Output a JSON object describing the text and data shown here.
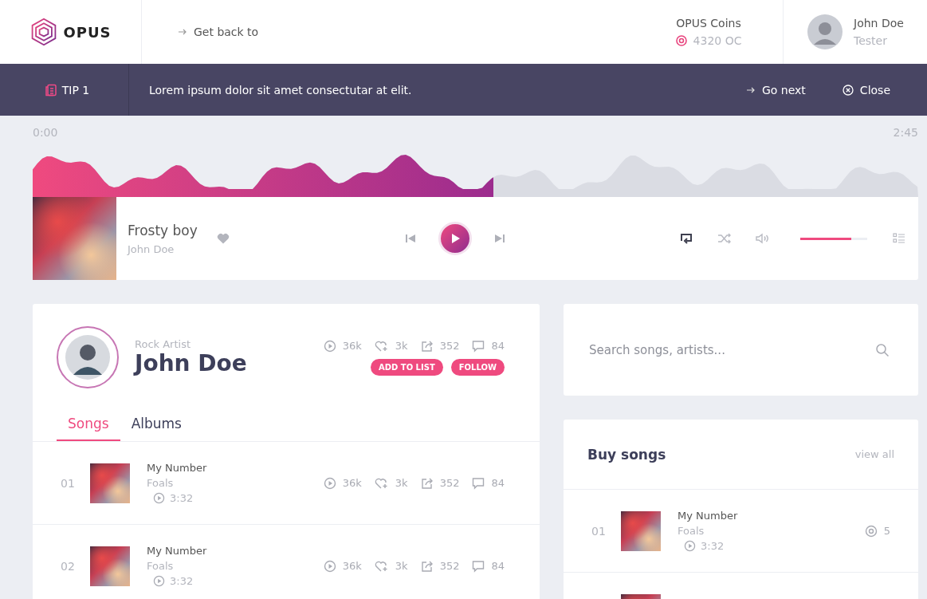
{
  "header": {
    "logo": "OPUS",
    "back_link": "Get back to",
    "coins_label": "OPUS Coins",
    "coins_value": "4320 OC",
    "user": {
      "name": "John Doe",
      "role": "Tester"
    }
  },
  "tip": {
    "label": "TIP 1",
    "text": "Lorem ipsum dolor sit amet consectutar at elit.",
    "next": "Go next",
    "close": "Close"
  },
  "player": {
    "elapsed": "0:00",
    "total": "2:45",
    "level": 0.52,
    "title": "Frosty boy",
    "artist": "John Doe",
    "repeat": true,
    "shuffle": false,
    "volume": {
      "level": 0.76
    }
  },
  "artist": {
    "genre": "Rock Artist",
    "name": "John Doe",
    "stats": [
      {
        "kind": "plays",
        "value": "36k"
      },
      {
        "kind": "likes",
        "value": "3k"
      },
      {
        "kind": "shares",
        "value": "352"
      },
      {
        "kind": "comments",
        "value": "84"
      }
    ],
    "actions": [
      "ADD TO LIST",
      "FOLLOW"
    ],
    "tabs": [
      {
        "label": "Songs",
        "selected": true
      },
      {
        "label": "Albums",
        "selected": false
      }
    ],
    "songs": [
      {
        "number": "01",
        "title": "My Number",
        "artist": "Foals",
        "duration": "3:32",
        "stats": [
          {
            "kind": "plays",
            "value": "36k"
          },
          {
            "kind": "likes",
            "value": "3k"
          },
          {
            "kind": "shares",
            "value": "352"
          },
          {
            "kind": "comments",
            "value": "84"
          }
        ]
      },
      {
        "number": "02",
        "title": "My Number",
        "artist": "Foals",
        "duration": "3:32",
        "stats": [
          {
            "kind": "plays",
            "value": "36k"
          },
          {
            "kind": "likes",
            "value": "3k"
          },
          {
            "kind": "shares",
            "value": "352"
          },
          {
            "kind": "comments",
            "value": "84"
          }
        ]
      }
    ]
  },
  "search": {
    "placeholder": "Search songs, artists..."
  },
  "buy_songs": {
    "title": "Buy songs",
    "view_all": "view all",
    "songs": [
      {
        "number": "01",
        "title": "My Number",
        "artist": "Foals",
        "duration": "3:32",
        "price": "5"
      }
    ]
  }
}
